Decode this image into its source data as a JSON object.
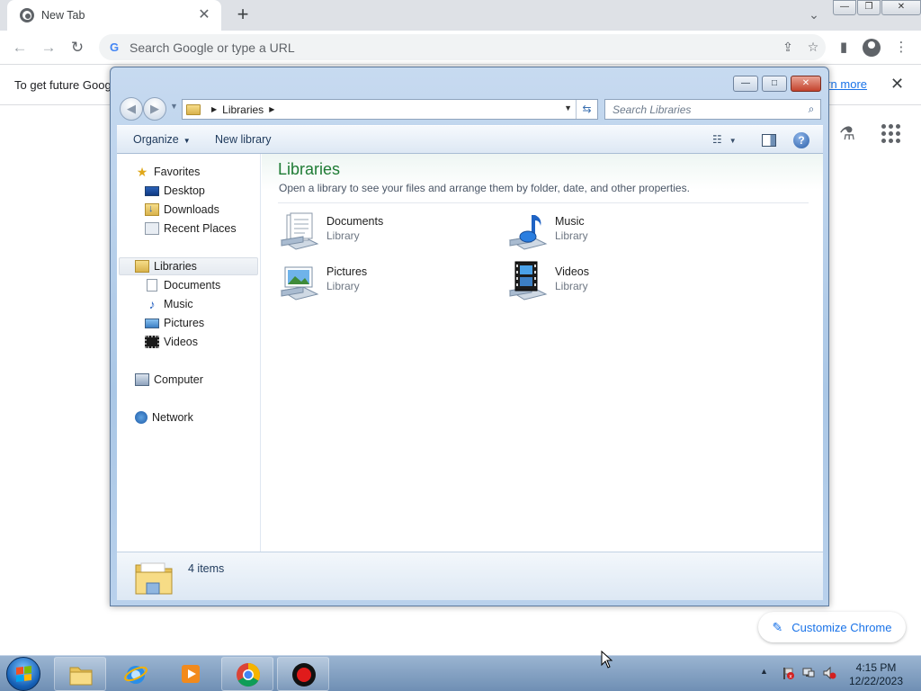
{
  "browser": {
    "tab_title": "New Tab",
    "tab_close": "✕",
    "new_tab": "+",
    "omnibox_placeholder": "Search Google or type a URL",
    "infobar_text": "To get future Goog",
    "infobar_link": "arn more",
    "infobar_close": "✕",
    "customize_label": "Customize Chrome",
    "window_controls": {
      "minimize": "—",
      "maximize": "❐",
      "close": "✕"
    }
  },
  "explorer": {
    "caption_buttons": {
      "minimize": "—",
      "maximize": "□",
      "close": "✕"
    },
    "breadcrumb": "Libraries",
    "search_placeholder": "Search Libraries",
    "commands": {
      "organize": "Organize",
      "new_library": "New library"
    },
    "nav_pane": {
      "favorites": "Favorites",
      "desktop": "Desktop",
      "downloads": "Downloads",
      "recent_places": "Recent Places",
      "libraries": "Libraries",
      "documents": "Documents",
      "music": "Music",
      "pictures": "Pictures",
      "videos": "Videos",
      "computer": "Computer",
      "network": "Network"
    },
    "content": {
      "title": "Libraries",
      "subtitle": "Open a library to see your files and arrange them by folder, date, and other properties.",
      "libraries": [
        {
          "name": "Documents",
          "kind": "Library"
        },
        {
          "name": "Music",
          "kind": "Library"
        },
        {
          "name": "Pictures",
          "kind": "Library"
        },
        {
          "name": "Videos",
          "kind": "Library"
        }
      ]
    },
    "details": {
      "count": "4 items"
    }
  },
  "taskbar": {
    "time": "4:15 PM",
    "date": "12/22/2023"
  },
  "colors": {
    "chrome_accent": "#1a73e8",
    "explorer_title_green": "#1e7b34",
    "taskbar": "#7f9cc0"
  }
}
